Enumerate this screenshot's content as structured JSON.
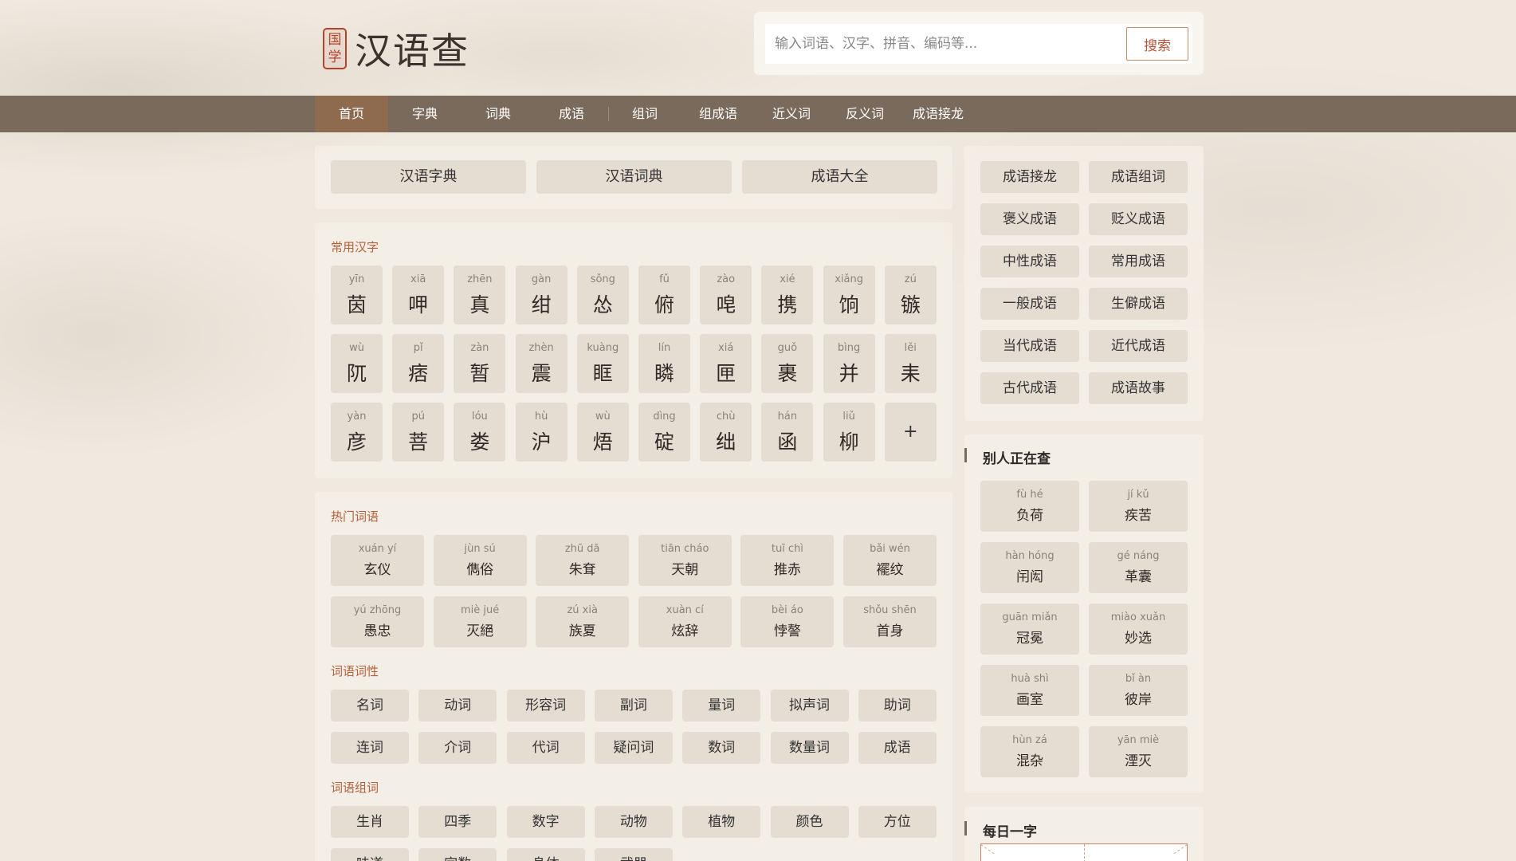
{
  "site": {
    "seal_chars": [
      "国",
      "学"
    ],
    "title": "汉语查"
  },
  "search": {
    "placeholder": "输入词语、汉字、拼音、编码等...",
    "button": "搜索"
  },
  "nav": [
    "首页",
    "字典",
    "词典",
    "成语",
    "组词",
    "组成语",
    "近义词",
    "反义词",
    "成语接龙"
  ],
  "top_links": [
    "汉语字典",
    "汉语词典",
    "成语大全"
  ],
  "common_chars": {
    "title": "常用汉字",
    "items": [
      {
        "py": "yīn",
        "ch": "茵"
      },
      {
        "py": "xiā",
        "ch": "呷"
      },
      {
        "py": "zhēn",
        "ch": "真"
      },
      {
        "py": "gàn",
        "ch": "绀"
      },
      {
        "py": "sǒng",
        "ch": "怂"
      },
      {
        "py": "fǔ",
        "ch": "俯"
      },
      {
        "py": "zào",
        "ch": "唣"
      },
      {
        "py": "xié",
        "ch": "携"
      },
      {
        "py": "xiǎng",
        "ch": "饷"
      },
      {
        "py": "zú",
        "ch": "镞"
      },
      {
        "py": "wù",
        "ch": "阢"
      },
      {
        "py": "pǐ",
        "ch": "痞"
      },
      {
        "py": "zàn",
        "ch": "暂"
      },
      {
        "py": "zhèn",
        "ch": "震"
      },
      {
        "py": "kuàng",
        "ch": "眶"
      },
      {
        "py": "lín",
        "ch": "瞵"
      },
      {
        "py": "xiá",
        "ch": "匣"
      },
      {
        "py": "guǒ",
        "ch": "裹"
      },
      {
        "py": "bìng",
        "ch": "并"
      },
      {
        "py": "lěi",
        "ch": "耒"
      },
      {
        "py": "yàn",
        "ch": "彦"
      },
      {
        "py": "pú",
        "ch": "菩"
      },
      {
        "py": "lóu",
        "ch": "娄"
      },
      {
        "py": "hù",
        "ch": "沪"
      },
      {
        "py": "wù",
        "ch": "焐"
      },
      {
        "py": "dìng",
        "ch": "碇"
      },
      {
        "py": "chù",
        "ch": "绌"
      },
      {
        "py": "hán",
        "ch": "函"
      },
      {
        "py": "liǔ",
        "ch": "柳"
      }
    ],
    "more": "+"
  },
  "hot_words": {
    "title": "热门词语",
    "items": [
      {
        "py": "xuán yí",
        "w": "玄仪"
      },
      {
        "py": "jùn sú",
        "w": "儁俗"
      },
      {
        "py": "zhū dā",
        "w": "朱耷"
      },
      {
        "py": "tiān cháo",
        "w": "天朝"
      },
      {
        "py": "tuī chì",
        "w": "推赤"
      },
      {
        "py": "bǎi wén",
        "w": "襬纹"
      },
      {
        "py": "yú zhōng",
        "w": "愚忠"
      },
      {
        "py": "miè jué",
        "w": "灭絕"
      },
      {
        "py": "zú xià",
        "w": "族夏"
      },
      {
        "py": "xuàn cí",
        "w": "炫辞"
      },
      {
        "py": "bèi áo",
        "w": "悖謷"
      },
      {
        "py": "shǒu shēn",
        "w": "首身"
      }
    ]
  },
  "pos": {
    "title": "词语词性",
    "items": [
      "名词",
      "动词",
      "形容词",
      "副词",
      "量词",
      "拟声词",
      "助词",
      "连词",
      "介词",
      "代词",
      "疑问词",
      "数词",
      "数量词",
      "成语"
    ]
  },
  "groups": {
    "title": "词语组词",
    "items": [
      "生肖",
      "四季",
      "数字",
      "动物",
      "植物",
      "颜色",
      "方位",
      "味道",
      "字数",
      "身体",
      "武器"
    ]
  },
  "side_links": [
    "成语接龙",
    "成语组词",
    "褒义成语",
    "贬义成语",
    "中性成语",
    "常用成语",
    "一般成语",
    "生僻成语",
    "当代成语",
    "近代成语",
    "古代成语",
    "成语故事"
  ],
  "others": {
    "title": "别人正在查",
    "items": [
      {
        "py": "fù hé",
        "w": "负荷"
      },
      {
        "py": "jí kǔ",
        "w": "疾苦"
      },
      {
        "py": "hàn hóng",
        "w": "闬闳"
      },
      {
        "py": "gé náng",
        "w": "革囊"
      },
      {
        "py": "guān miǎn",
        "w": "冠冕"
      },
      {
        "py": "miào xuǎn",
        "w": "妙选"
      },
      {
        "py": "huà shì",
        "w": "画室"
      },
      {
        "py": "bǐ àn",
        "w": "彼岸"
      },
      {
        "py": "hùn zá",
        "w": "混杂"
      },
      {
        "py": "yān miè",
        "w": "湮灭"
      }
    ]
  },
  "daily": {
    "title": "每日一字"
  }
}
